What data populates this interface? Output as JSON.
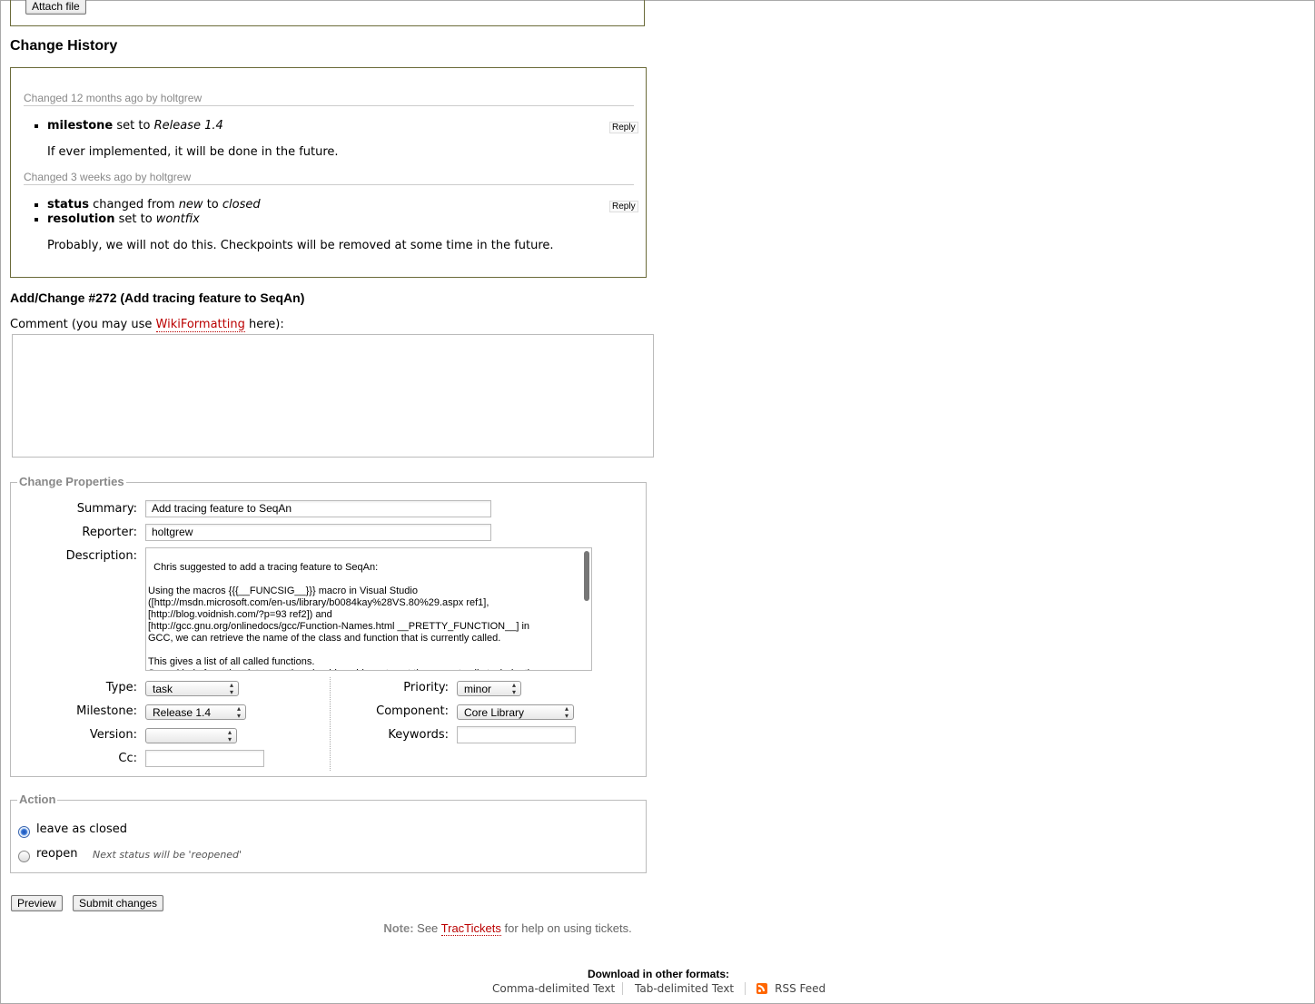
{
  "attach": {
    "label": "Attach file"
  },
  "history": {
    "title": "Change History",
    "changes": [
      {
        "prefix": "Changed ",
        "when": "12 months ago",
        "by": " by ",
        "author": "holtgrew",
        "reply": "Reply",
        "fields": [
          {
            "name": "milestone",
            "text": " set to ",
            "value": "Release 1.4"
          }
        ],
        "comment": "If ever implemented, it will be done in the future."
      },
      {
        "prefix": "Changed ",
        "when": "3 weeks ago",
        "by": " by ",
        "author": "holtgrew",
        "reply": "Reply",
        "fields": [
          {
            "name": "status",
            "text1": " changed from ",
            "from": "new",
            "text2": " to ",
            "to": "closed"
          },
          {
            "name": "resolution",
            "text": " set to ",
            "value": "wontfix"
          }
        ],
        "comment": "Probably, we will not do this. Checkpoints will be removed at some time in the future."
      }
    ]
  },
  "add": {
    "title": "Add/Change #272 (Add tracing feature to SeqAn)",
    "comment_prefix": "Comment (you may use ",
    "comment_link": "WikiFormatting",
    "comment_suffix": " here):",
    "comment_value": ""
  },
  "props": {
    "legend": "Change Properties",
    "summary_label": "Summary:",
    "summary_value": "Add tracing feature to SeqAn",
    "reporter_label": "Reporter:",
    "reporter_value": "holtgrew",
    "description_label": "Description:",
    "description_value": "Chris suggested to add a tracing feature to SeqAn:\n\nUsing the macros {{{__FUNCSIG__}}} macro in Visual Studio\n([http://msdn.microsoft.com/en-us/library/b0084kay%28VS.80%29.aspx ref1],\n[http://blog.voidnish.com/?p=93 ref2]) and\n[http://gcc.gnu.org/onlinedocs/gcc/Function-Names.html __PRETTY_FUNCTION__] in\nGCC, we can retrieve the name of the class and function that is currently called.\n\nThis gives a list of all called functions.\nSome kind of run time introspection should enable us to get the current call stack depth,",
    "type_label": "Type:",
    "type_value": "task",
    "milestone_label": "Milestone:",
    "milestone_value": "Release 1.4",
    "version_label": "Version:",
    "version_value": "",
    "cc_label": "Cc:",
    "cc_value": "",
    "priority_label": "Priority:",
    "priority_value": "minor",
    "component_label": "Component:",
    "component_value": "Core Library",
    "keywords_label": "Keywords:",
    "keywords_value": ""
  },
  "action": {
    "legend": "Action",
    "leave_label": "leave as closed",
    "reopen_label": "reopen",
    "reopen_hint": "Next status will be 'reopened'",
    "selected": "leave"
  },
  "buttons": {
    "preview": "Preview",
    "submit": "Submit changes"
  },
  "note": {
    "bold": "Note:",
    "pre": " See ",
    "link": "TracTickets",
    "post": " for help on using tickets."
  },
  "download": {
    "title": "Download in other formats:",
    "csv": "Comma-delimited Text",
    "tab": "Tab-delimited Text",
    "rss": "RSS Feed"
  },
  "colors": {
    "link": "#bb0000",
    "box_border": "#6b6b3a",
    "muted": "#888888",
    "rss": "#ff6600"
  },
  "icons": {
    "rss": "rss-icon",
    "radio_on": "radio-selected-icon",
    "radio_off": "radio-empty-icon",
    "dropdown": "chevron-updown-icon"
  }
}
